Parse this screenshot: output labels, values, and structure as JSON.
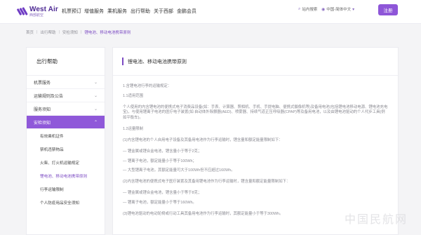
{
  "brand": {
    "title": "West Air",
    "subtitle": "西部航空"
  },
  "nav": [
    {
      "label": "机票预订"
    },
    {
      "label": "增值服务"
    },
    {
      "label": "乘机服务"
    },
    {
      "label": "出行帮助"
    },
    {
      "label": "关于西部"
    },
    {
      "label": "金鹏会员"
    }
  ],
  "header_tools": {
    "search": "站内搜索",
    "language": "中国-简体中文",
    "login": "注册"
  },
  "breadcrumb": [
    "首页",
    "出行帮助",
    "安检须知",
    "锂电池、移动电池携带原则"
  ],
  "sidebar": {
    "title": "出行帮助",
    "items": [
      {
        "label": "机票服务",
        "active": false
      },
      {
        "label": "运输规则及公告",
        "active": false
      },
      {
        "label": "服务须知",
        "active": false
      },
      {
        "label": "安检须知",
        "active": true
      }
    ],
    "subitems": [
      {
        "label": "有效乘机证件"
      },
      {
        "label": "禁机违禁物品"
      },
      {
        "label": "火柴、打火机运输规定"
      },
      {
        "label": "锂电池、移动电池携带原则"
      },
      {
        "label": "行李运输限制"
      },
      {
        "label": "个人防疫用品安全须知"
      }
    ]
  },
  "content": {
    "title": "锂电池、移动电池携带原则",
    "paragraphs": [
      "1.含锂电池行李的运输规定：",
      "1.1适用范围",
      "个人使用的内含锂电池的便携式电子消费品设备(如：手表、计算器、照相机、手机、手提电脑、便携式摄像机等)及备用电池(包括锂电池移动电源、锂电池充电宝)，与使用锂离子电池的医疗电子装置(如:自动体外除颤器(AED)、喷雾器、持续气道正压呼吸器(CPAP)等及备用电池，以及由锂电池驱动的个人代步工具(例如平衡车)。",
      "1.2运量限制",
      "(1)内含锂电池的个人自用电子设备及其备用电池作为行李运输时，锂含量和额定能量限制如下：",
      "— 锂金属或锂合金电池，锂含量小于等于2克；",
      "— 锂离子电池，额定能量小于等于100Wh；",
      "— 大型锂离子电池，其额定能量可大于100Wh但不应超过160Wh。",
      "(2)内含锂电池的便携式电子医疗装置及其备用锂电池作为行李运输时，锂含量和额定能量限制如下：",
      "— 锂金属或锂合金电池，锂含量小于等于8克；",
      "— 锂离子电池，额定能量小于等于160Wh。",
      "(3)锂电池驱动的电动轮椅或行动工具其备用电池作为行李运输时，其额定能量小于等于300Wh。"
    ]
  },
  "colors": {
    "accent": "#8e56d8",
    "text_link": "#7c4bc3"
  }
}
